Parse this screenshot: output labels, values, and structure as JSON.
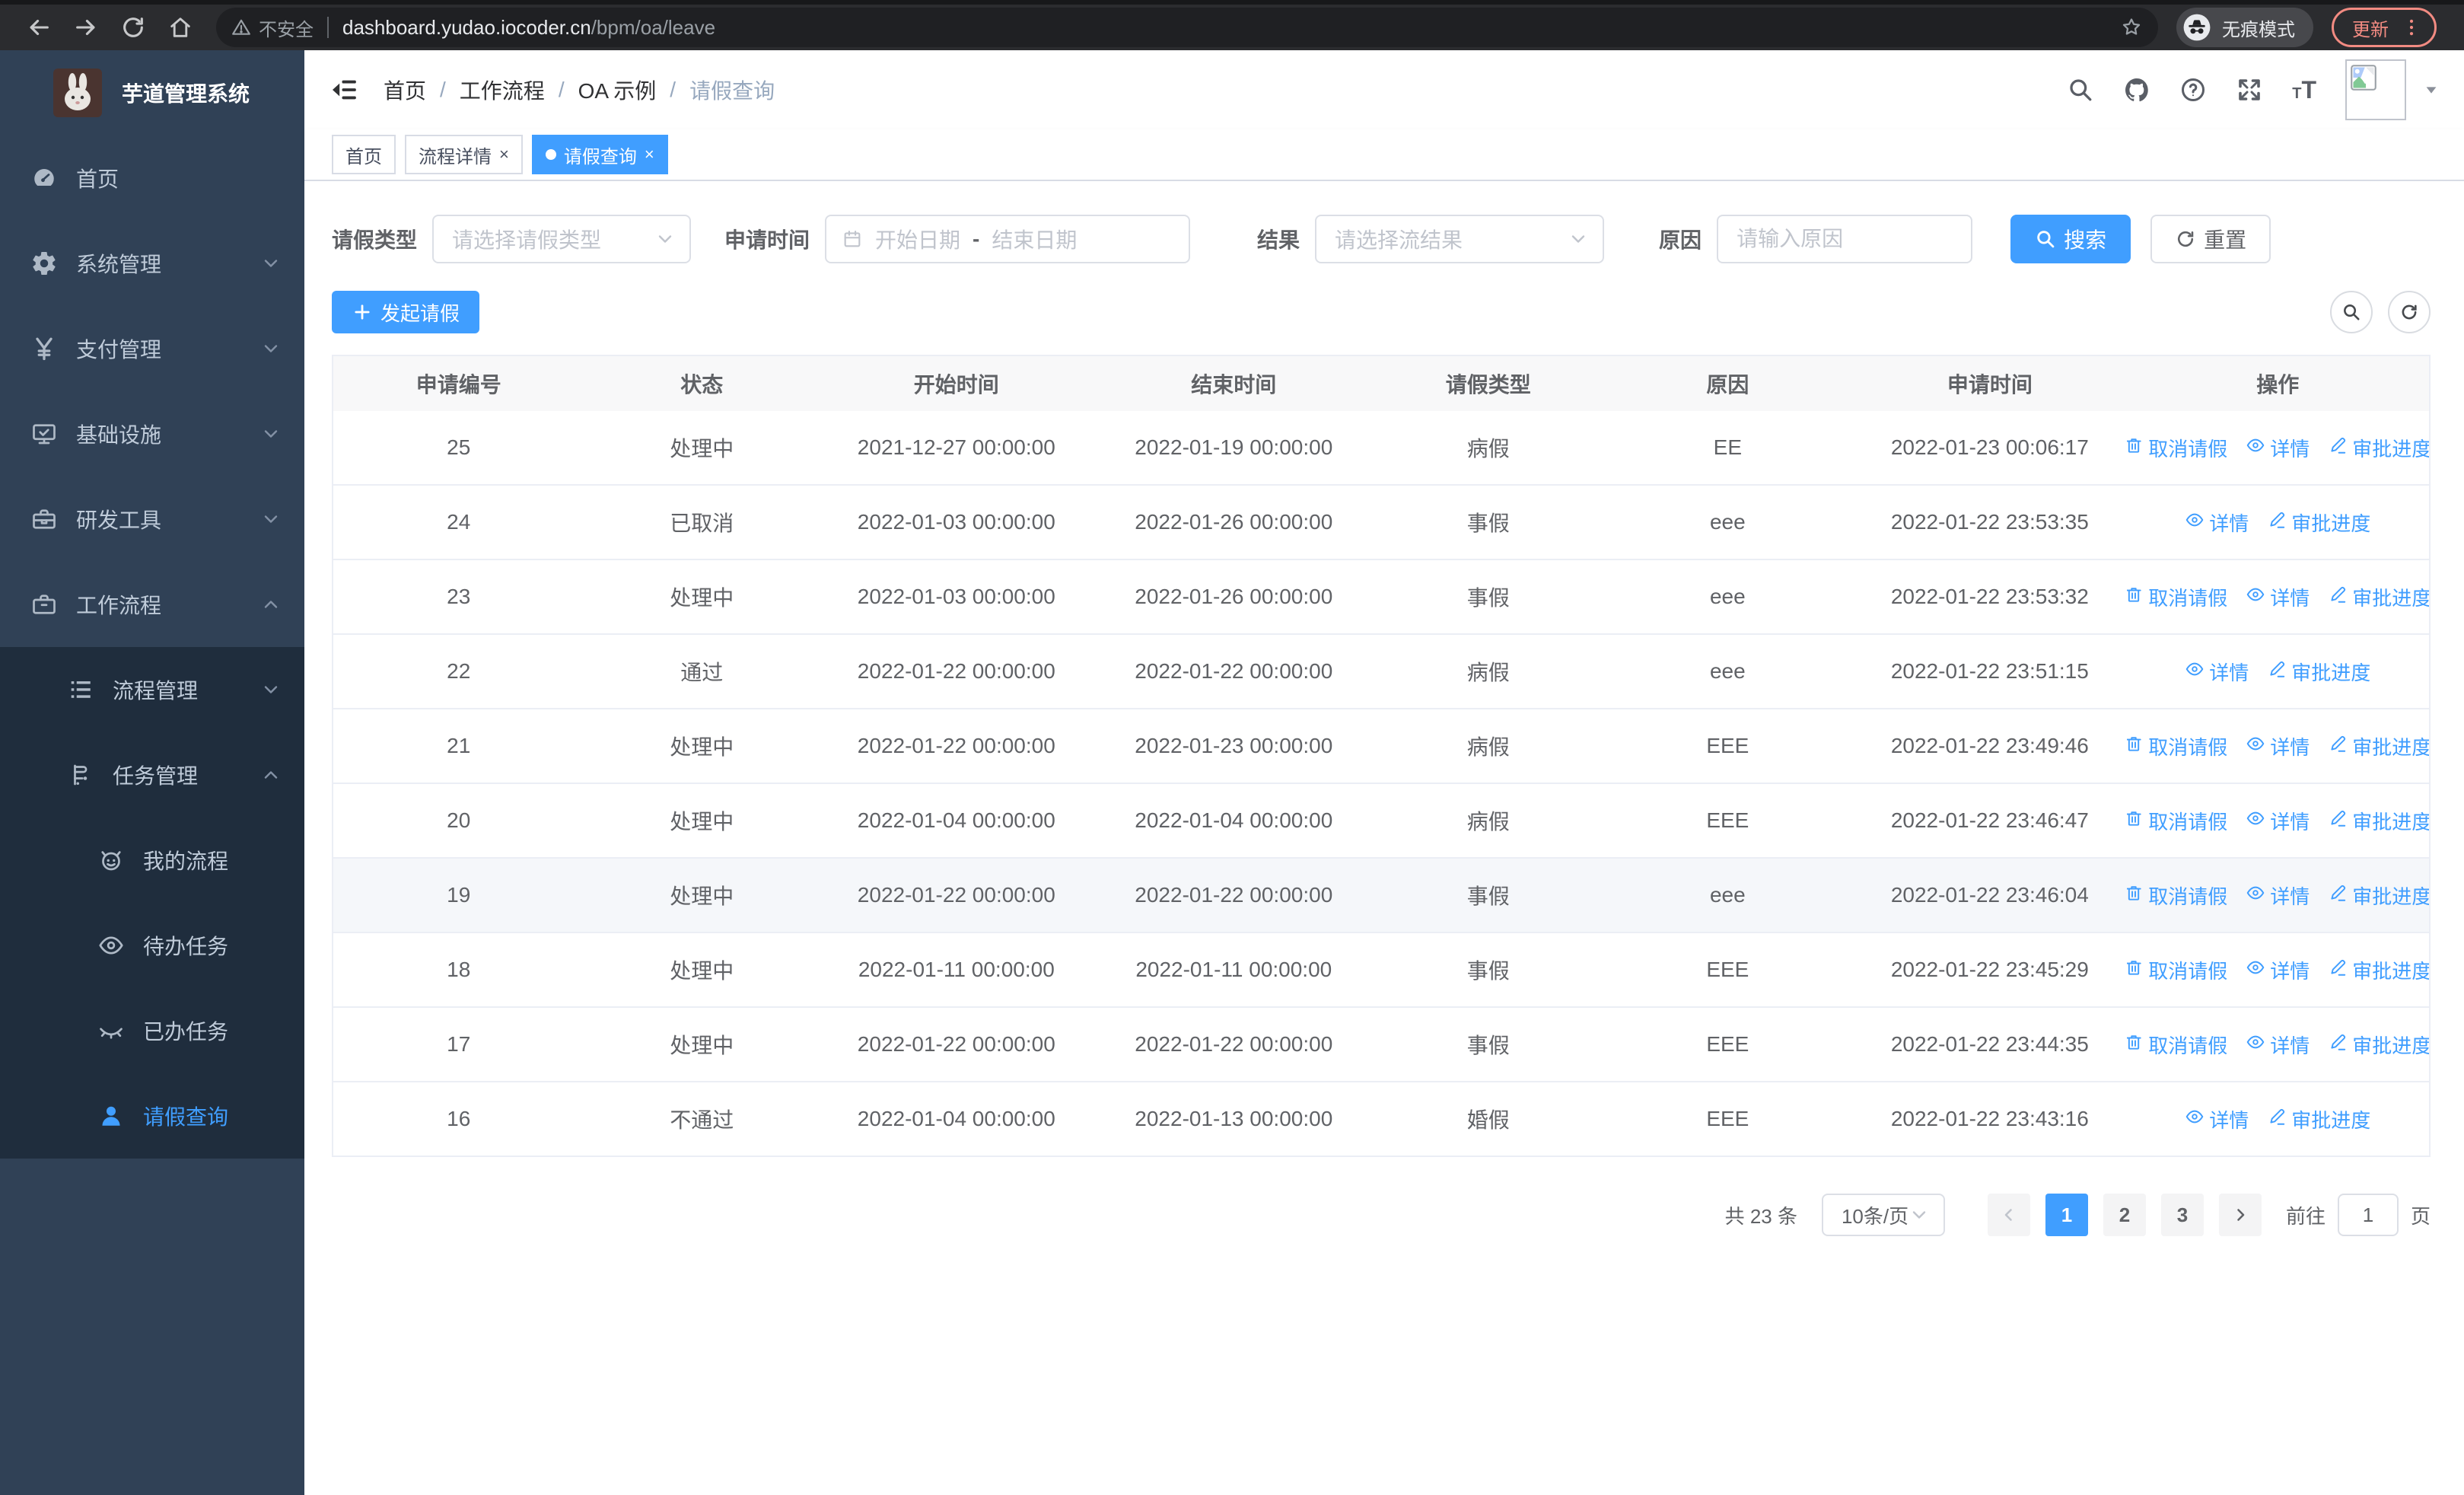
{
  "colors": {
    "primary": "#409EFF"
  },
  "browser": {
    "security_label": "不安全",
    "url_host": "dashboard.yudao.iocoder.cn",
    "url_path": "/bpm/oa/leave",
    "incognito_label": "无痕模式",
    "update_label": "更新"
  },
  "sidebar": {
    "title": "芋道管理系统",
    "menu": [
      {
        "key": "home",
        "label": "首页",
        "icon": "dashboard-icon",
        "level": 1
      },
      {
        "key": "system",
        "label": "系统管理",
        "icon": "gear-icon",
        "level": 1,
        "arrow": "down"
      },
      {
        "key": "payment",
        "label": "支付管理",
        "icon": "yen-icon",
        "level": 1,
        "arrow": "down"
      },
      {
        "key": "infra",
        "label": "基础设施",
        "icon": "monitor-icon",
        "level": 1,
        "arrow": "down"
      },
      {
        "key": "devtools",
        "label": "研发工具",
        "icon": "toolbox-icon",
        "level": 1,
        "arrow": "down"
      },
      {
        "key": "workflow",
        "label": "工作流程",
        "icon": "briefcase-icon",
        "level": 1,
        "arrow": "up"
      },
      {
        "key": "process-mgmt",
        "label": "流程管理",
        "icon": "list-tree-icon",
        "level": 2,
        "arrow": "down",
        "group": true
      },
      {
        "key": "task-mgmt",
        "label": "任务管理",
        "icon": "flag-icon",
        "level": 2,
        "arrow": "up",
        "group": true
      },
      {
        "key": "my-process",
        "label": "我的流程",
        "icon": "robot-icon",
        "level": 3,
        "group": true
      },
      {
        "key": "todo-tasks",
        "label": "待办任务",
        "icon": "eye-open-icon",
        "level": 3,
        "group": true
      },
      {
        "key": "done-tasks",
        "label": "已办任务",
        "icon": "eye-closed-icon",
        "level": 3,
        "group": true
      },
      {
        "key": "leave-query",
        "label": "请假查询",
        "icon": "user-icon",
        "level": 3,
        "group": true,
        "active": true
      }
    ]
  },
  "header": {
    "breadcrumb": [
      "首页",
      "工作流程",
      "OA 示例",
      "请假查询"
    ]
  },
  "tabs": [
    {
      "label": "首页",
      "closable": false,
      "active": false
    },
    {
      "label": "流程详情",
      "closable": true,
      "active": false
    },
    {
      "label": "请假查询",
      "closable": true,
      "active": true
    }
  ],
  "filters": {
    "leave_type_label": "请假类型",
    "leave_type_placeholder": "请选择请假类型",
    "apply_time_label": "申请时间",
    "date_start_placeholder": "开始日期",
    "date_separator": "-",
    "date_end_placeholder": "结束日期",
    "result_label": "结果",
    "result_placeholder": "请选择流结果",
    "reason_label": "原因",
    "reason_placeholder": "请输入原因",
    "search_label": "搜索",
    "reset_label": "重置"
  },
  "toolbar": {
    "create_label": "发起请假"
  },
  "table": {
    "headers": [
      "申请编号",
      "状态",
      "开始时间",
      "结束时间",
      "请假类型",
      "原因",
      "申请时间",
      "操作"
    ],
    "action_labels": {
      "cancel": "取消请假",
      "detail": "详情",
      "progress": "审批进度"
    },
    "rows": [
      {
        "id": "25",
        "status": "处理中",
        "start": "2021-12-27 00:00:00",
        "end": "2022-01-19 00:00:00",
        "type": "病假",
        "reason": "EE",
        "applied": "2022-01-23 00:06:17",
        "actions": [
          "cancel",
          "detail",
          "progress"
        ]
      },
      {
        "id": "24",
        "status": "已取消",
        "start": "2022-01-03 00:00:00",
        "end": "2022-01-26 00:00:00",
        "type": "事假",
        "reason": "eee",
        "applied": "2022-01-22 23:53:35",
        "actions": [
          "detail",
          "progress"
        ]
      },
      {
        "id": "23",
        "status": "处理中",
        "start": "2022-01-03 00:00:00",
        "end": "2022-01-26 00:00:00",
        "type": "事假",
        "reason": "eee",
        "applied": "2022-01-22 23:53:32",
        "actions": [
          "cancel",
          "detail",
          "progress"
        ]
      },
      {
        "id": "22",
        "status": "通过",
        "start": "2022-01-22 00:00:00",
        "end": "2022-01-22 00:00:00",
        "type": "病假",
        "reason": "eee",
        "applied": "2022-01-22 23:51:15",
        "actions": [
          "detail",
          "progress"
        ]
      },
      {
        "id": "21",
        "status": "处理中",
        "start": "2022-01-22 00:00:00",
        "end": "2022-01-23 00:00:00",
        "type": "病假",
        "reason": "EEE",
        "applied": "2022-01-22 23:49:46",
        "actions": [
          "cancel",
          "detail",
          "progress"
        ]
      },
      {
        "id": "20",
        "status": "处理中",
        "start": "2022-01-04 00:00:00",
        "end": "2022-01-04 00:00:00",
        "type": "病假",
        "reason": "EEE",
        "applied": "2022-01-22 23:46:47",
        "actions": [
          "cancel",
          "detail",
          "progress"
        ]
      },
      {
        "id": "19",
        "status": "处理中",
        "start": "2022-01-22 00:00:00",
        "end": "2022-01-22 00:00:00",
        "type": "事假",
        "reason": "eee",
        "applied": "2022-01-22 23:46:04",
        "actions": [
          "cancel",
          "detail",
          "progress"
        ],
        "highlighted": true
      },
      {
        "id": "18",
        "status": "处理中",
        "start": "2022-01-11 00:00:00",
        "end": "2022-01-11 00:00:00",
        "type": "事假",
        "reason": "EEE",
        "applied": "2022-01-22 23:45:29",
        "actions": [
          "cancel",
          "detail",
          "progress"
        ]
      },
      {
        "id": "17",
        "status": "处理中",
        "start": "2022-01-22 00:00:00",
        "end": "2022-01-22 00:00:00",
        "type": "事假",
        "reason": "EEE",
        "applied": "2022-01-22 23:44:35",
        "actions": [
          "cancel",
          "detail",
          "progress"
        ]
      },
      {
        "id": "16",
        "status": "不通过",
        "start": "2022-01-04 00:00:00",
        "end": "2022-01-13 00:00:00",
        "type": "婚假",
        "reason": "EEE",
        "applied": "2022-01-22 23:43:16",
        "actions": [
          "detail",
          "progress"
        ]
      }
    ]
  },
  "pagination": {
    "total_label": "共 23 条",
    "page_size": "10条/页",
    "pages": [
      "1",
      "2",
      "3"
    ],
    "current": "1",
    "goto_label": "前往",
    "goto_value": "1",
    "goto_suffix": "页"
  }
}
